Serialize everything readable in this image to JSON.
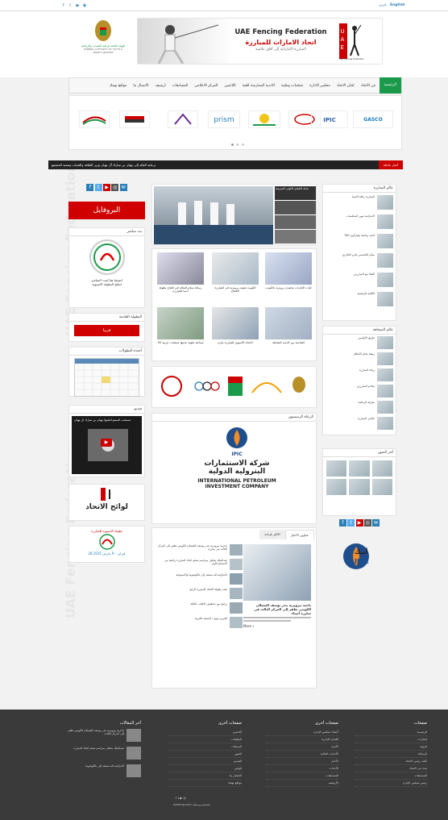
{
  "topbar": {
    "lang_en": "English",
    "lang_ar": "عربي"
  },
  "header": {
    "org_left": "الهيئة العامة لرعاية الشباب والرياضة",
    "org_left_en": "GENERAL AUTHORITY OF YOUTH & SPORTS WELFARE",
    "banner_en": "UAE Fencing Federation",
    "banner_ar": "اتحاد الامارات للمبارزة",
    "banner_tag": "المبارزة الاماراتية إلى آفاق عالمية",
    "logo_caption": "UAE Fencing Federation"
  },
  "nav": {
    "items": [
      "الرئيسية",
      "عن الاتحاد",
      "لجان الاتحاد",
      "مجلس الادارة",
      "منتخبات وطنية",
      "الاندية الممارسة للعبة",
      "اللاعبين",
      "المركز الاعلامي",
      "المسابقات",
      "أرشيف",
      "الاتصال بنا",
      "مواقع تهمك"
    ]
  },
  "sponsors": [
    "GASCO",
    "IPIC",
    "",
    "",
    "prism",
    "",
    "",
    ""
  ],
  "ticker": {
    "label": "أخبار عاجلة",
    "text": "برعاية القائد إلى نهيان بن مبارك آل نهيان وزير الثقافة والشباب وتنمية المجتمع"
  },
  "sidebar_left": {
    "profile_label": "البروفايل",
    "live_title": "بث مباشر",
    "live_caption_1": "اضغط هنا لتبث المباشر",
    "live_caption_2": "لنتائج البطولة الاسيوية",
    "next_champ_title": "البطولة القادمة",
    "next_champ_btn": "قريبا",
    "calendar_title": "أجندة البطولات",
    "video_title": "فيديو",
    "video_caption": "مستحب السمو الشيخ/ نهيان بن مبارك آل نهيان",
    "regulations": "لوائح الاتحاد",
    "poster_title": "بطولة الاسيوية للمبارزة",
    "poster_date": "28 فبراير – 9 مارس 2015"
  },
  "center": {
    "slider_items": [
      "عدلة الافتتاح الالولى الصريحة",
      "",
      "",
      ""
    ],
    "news": [
      {
        "title": "رسالة سلام للنعالة في افتتاح بطولة آسيا للمبارزة"
      },
      {
        "title": "الكويت تضيف برونزية في المبارزة الافتتاح"
      },
      {
        "title": "كبات الإمارات بحصدن برونزية بالكويت"
      },
      {
        "title": "30 ميدالية ملونة عدمها منتخبات عربية"
      },
      {
        "title": "الاتحاد الآسيوي للمبارزة يكرم"
      },
      {
        "title": "افتتاحية ببن الاندية الشاملة"
      }
    ],
    "sponsors_title": "الرعاة الرسميون",
    "ipic_ar": "شركة الاستثمارات البترولية الدولية",
    "ipic_en_1": "INTERNATIONAL PETROLEUM",
    "ipic_en_2": "INVESTMENT COMPANY",
    "ipic_abbr": "IPIC",
    "tabs": [
      "عناوين الاخبار",
      "الاكثر قراءة"
    ],
    "feature_title": "ياخية بيرونزية بتدر يوسف الشملان الكويتي تظفر إلى المركز الثالث في مبارزة أسياء",
    "feature_more": "More »",
    "list": [
      "باخرية بيرونزية بتدر يوسف الشملان الكويتي تظفر إلى المركز الثالث في مبارزة",
      "عبدالملك يحظى بمراسم تسلم اتحاد المبارزة رياضيا من الاجتماع الأول",
      "الاماراتية لله تستعد إلى بالكونفونيا والأستوانبة",
      "نقدم بطولة الاتحاد للمبارزة الرابع",
      "برامج بين يحتفلون الالقاب الثالثة",
      "العربي يتوج بـ السيف العربية"
    ]
  },
  "sidebar_right": {
    "b1_title": "عالم المبارزة",
    "b1_items": [
      "المبارزة رائعة الاسيا",
      "الاماراتية تنهي المنافسات",
      "700 لاعب ولاعبة يشاركون",
      "سلام القاسمي يكرم الفائزين",
      "اللقاء مع المبارزين",
      "الكلمة الرئيسية"
    ],
    "b2_title": "عالم الصحافة",
    "b2_items": [
      "طريق الأولمبي",
      "ريشة تختار الأبطال",
      "ريادة المبارزة",
      "ملاحم المبارزين",
      "معرفة الرياضة",
      "عالمي المبارزة"
    ],
    "gallery_title": "أخر الصور",
    "ipic_ar": "أيبك",
    "ipic_en": "IPIC"
  },
  "footer": {
    "col1_title": "صفحات",
    "col1": [
      "الرئيسية",
      "إنجازات",
      "الرؤية",
      "الرسالة",
      "كلمة رئيس الاتحاد",
      "نبذة عن الاتحاد",
      "المسابقات",
      "رئيس مجلس الإدارة"
    ],
    "col2_title": "صفحات أخرى",
    "col2": [
      "أعضاء مجلس الإدارة",
      "اللجان الإدارية",
      "الأندية",
      "الأحداث الحالية",
      "الأخبار",
      "الأحداث",
      "المسابقات",
      "الأرشيف"
    ],
    "col3_title": "صفحات أخرى",
    "col3": [
      "اللاعبين",
      "البطولات",
      "السجلات",
      "الصور",
      "الفيديو",
      "قوانين",
      "الاتصال بنا",
      "مواقع تهمك"
    ],
    "col4_title": "أخر المقالات",
    "col4": [
      "باخرية بيرونزية بتدر يوسف الشملان الكويتي تظفر إلى المركز الثالث",
      "عبدالملك يحظى بمراسم تسلم اتحاد المبارزة",
      "الاماراتية لله تستعد إلى بالكونفونيا"
    ],
    "credit": "loewing.com تصميم وبرمجة"
  },
  "colors": {
    "accent": "#1a9a4a",
    "red": "#d00000",
    "dark": "#3a3a3a"
  }
}
